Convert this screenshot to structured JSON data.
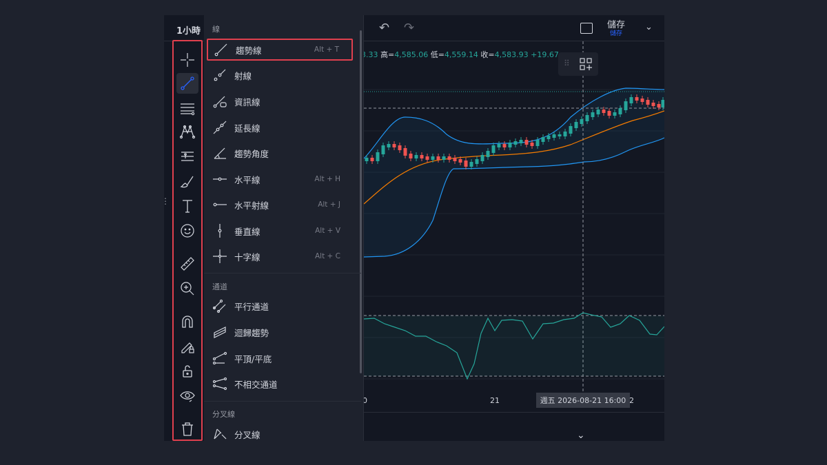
{
  "header": {
    "timeframe": "1小時",
    "undo_icon": "undo-icon",
    "redo_icon": "redo-icon",
    "save_label": "儲存",
    "save_sub": "儲存",
    "chevron": "⌄"
  },
  "ohlc": {
    "open_tail": "3.33",
    "high_label": "高=",
    "high": "4,585.06",
    "low_label": "低=",
    "low": "4,559.14",
    "close_label": "收=",
    "close": "4,583.93",
    "change": "+19.67"
  },
  "left_toolbar": {
    "tools": [
      "crosshair-icon",
      "trend-line-icon",
      "fib-icon",
      "pattern-icon",
      "prediction-icon",
      "brush-icon",
      "text-icon",
      "emoji-icon",
      "ruler-icon",
      "zoom-icon",
      "magnet-icon",
      "lock-drawing-icon",
      "lock-icon",
      "eye-icon",
      "trash-icon"
    ]
  },
  "menu": {
    "sections": [
      {
        "title": "線"
      },
      {
        "title": "通道"
      },
      {
        "title": "分叉線"
      }
    ],
    "items": [
      {
        "label": "趨勢線",
        "shortcut": "Alt + T"
      },
      {
        "label": "射線",
        "shortcut": ""
      },
      {
        "label": "資訊線",
        "shortcut": ""
      },
      {
        "label": "延長線",
        "shortcut": ""
      },
      {
        "label": "趨勢角度",
        "shortcut": ""
      },
      {
        "label": "水平線",
        "shortcut": "Alt + H"
      },
      {
        "label": "水平射線",
        "shortcut": "Alt + J"
      },
      {
        "label": "垂直線",
        "shortcut": "Alt + V"
      },
      {
        "label": "十字線",
        "shortcut": "Alt + C"
      },
      {
        "label": "平行通道",
        "shortcut": ""
      },
      {
        "label": "迴歸趨勢",
        "shortcut": ""
      },
      {
        "label": "平頂/平底",
        "shortcut": ""
      },
      {
        "label": "不相交通道",
        "shortcut": ""
      },
      {
        "label": "分叉線",
        "shortcut": ""
      }
    ]
  },
  "chart": {
    "x_labels": [
      "0",
      "21",
      "2"
    ],
    "date_badge": "週五 2026-08-21   16:00",
    "bottom_chevron": "⌄",
    "colors": {
      "up": "#26a69a",
      "down": "#ef5350",
      "band": "#2196f3",
      "ma": "#f57c00",
      "osc": "#26a69a"
    }
  }
}
